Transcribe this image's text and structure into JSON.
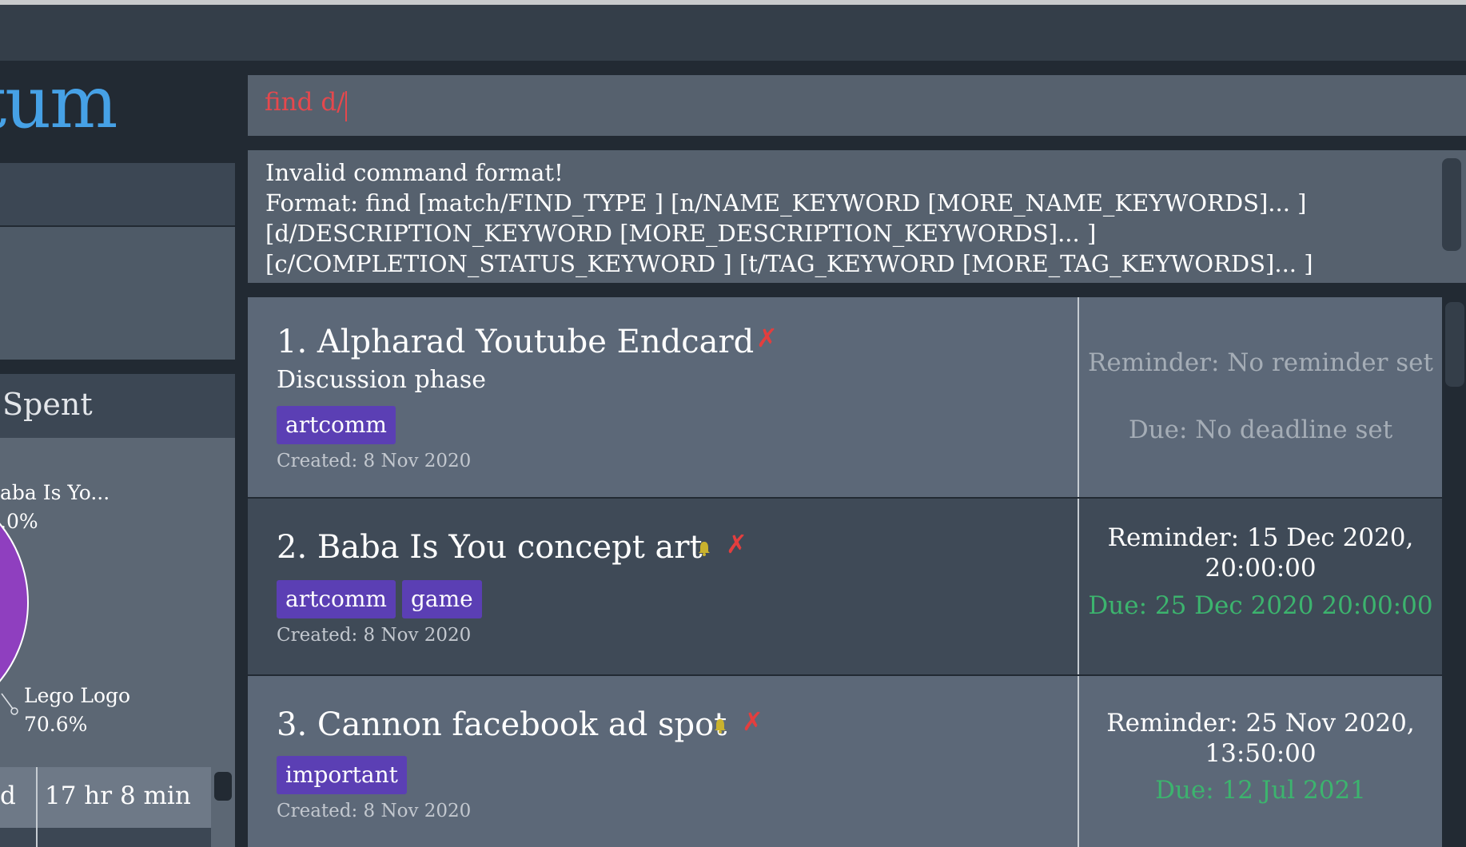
{
  "app": {
    "title": "tum"
  },
  "command": {
    "value": "find d/"
  },
  "result": {
    "lines": [
      "Invalid command format!",
      "Format: find [match/FIND_TYPE ] [n/NAME_KEYWORD [MORE_NAME_KEYWORDS]... ]",
      "[d/DESCRIPTION_KEYWORD [MORE_DESCRIPTION_KEYWORDS]... ]",
      "[c/COMPLETION_STATUS_KEYWORD ] [t/TAG_KEYWORD [MORE_TAG_KEYWORDS]... ]"
    ]
  },
  "stats": {
    "title": "Spent",
    "pie": [
      {
        "label": "aba Is Yo...",
        "percent": ".0%"
      },
      {
        "label": "Lego Logo",
        "percent": "70.6%"
      }
    ],
    "time_label": "d",
    "time_value": "17 hr 8 min"
  },
  "tasks": [
    {
      "name": "1. Alpharad Youtube Endcard",
      "description": "Discussion phase",
      "tags": [
        "artcomm"
      ],
      "created": "Created: 8 Nov 2020",
      "reminder": "Reminder: No reminder set",
      "due": "Due: No deadline set",
      "has_reminder": false
    },
    {
      "name": "2. Baba Is You concept art",
      "description": "",
      "tags": [
        "artcomm",
        "game"
      ],
      "created": "Created: 8 Nov 2020",
      "reminder": "Reminder: 15 Dec 2020, 20:00:00",
      "due": "Due: 25 Dec 2020 20:00:00",
      "has_reminder": true
    },
    {
      "name": "3. Cannon facebook ad spot",
      "description": "",
      "tags": [
        "important"
      ],
      "created": "Created: 8 Nov 2020",
      "reminder": "Reminder: 25 Nov 2020, 13:50:00",
      "due": "Due: 12 Jul 2021",
      "has_reminder": true
    }
  ],
  "icons": {
    "incomplete": "cross-icon",
    "reminder": "bell-icon"
  },
  "colors": {
    "accent": "#46a1e6",
    "error_text": "#e5484d",
    "tag": "#5b3fb4",
    "due_green": "#3cb46e",
    "muted_reminder": "#a5adb6",
    "cross_red": "#e33e3e",
    "bell_yellow": "#c9b22e"
  }
}
